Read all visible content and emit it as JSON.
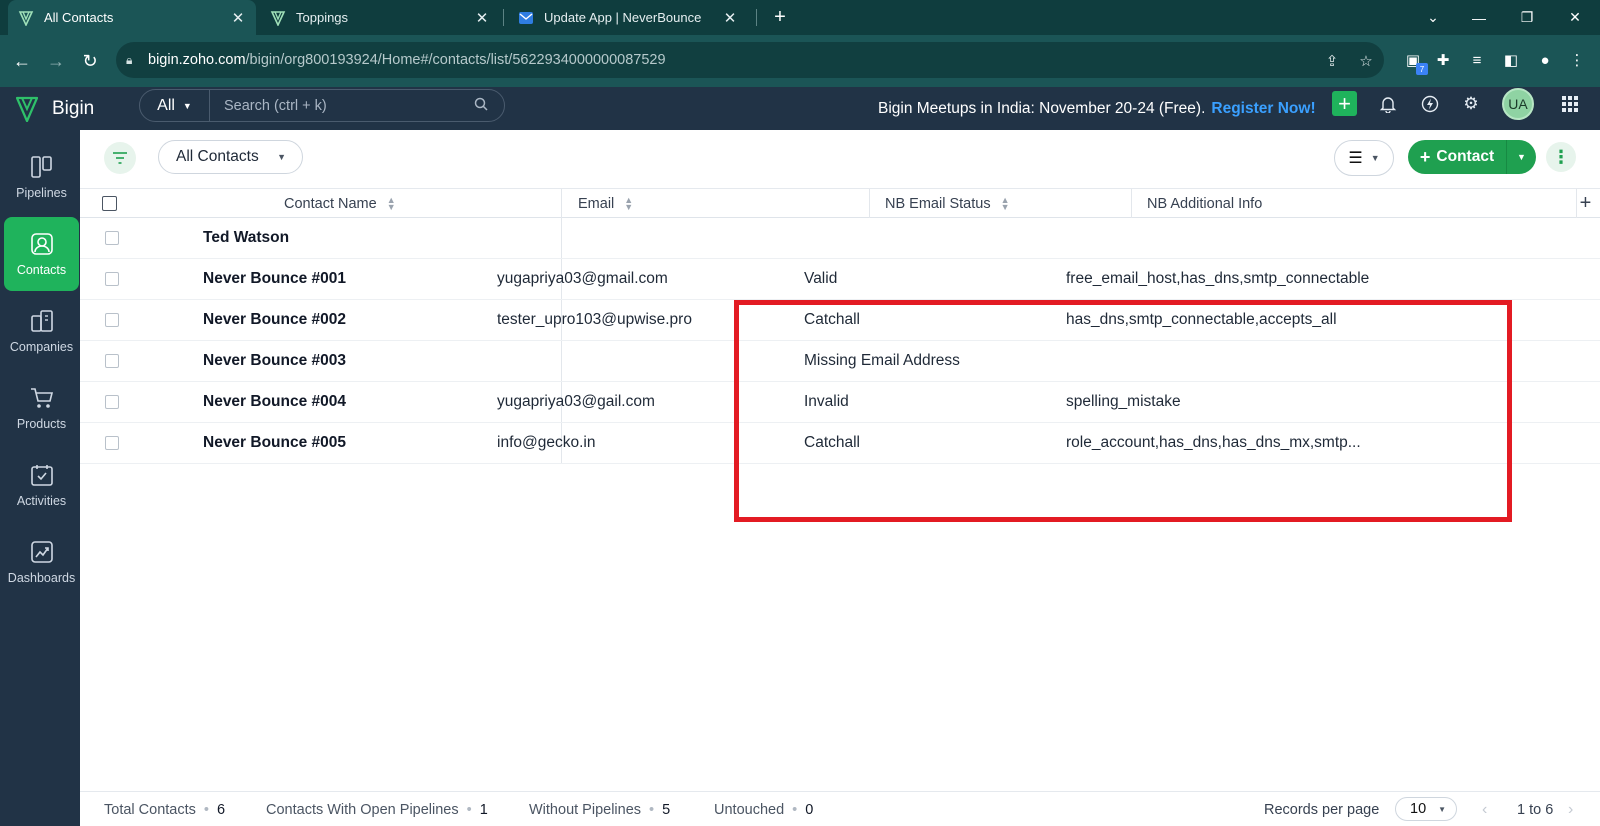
{
  "browser": {
    "tabs": [
      {
        "title": "All Contacts",
        "active": true,
        "icon": "bigin-logo-icon"
      },
      {
        "title": "Toppings",
        "active": false,
        "icon": "bigin-logo-icon"
      },
      {
        "title": "Update App | NeverBounce",
        "active": false,
        "icon": "neverbounce-logo-icon"
      }
    ],
    "url_host": "bigin.zoho.com",
    "url_path": "/bigin/org800193924/Home#/contacts/list/5622934000000087529",
    "extension_badge": "7"
  },
  "app": {
    "name": "Bigin",
    "search_scope": "All",
    "search_placeholder": "Search (ctrl + k)",
    "promo_text": "Bigin Meetups in India: November 20-24 (Free).",
    "promo_link": "Register Now!",
    "avatar_initials": "UA",
    "brand_color": "#1fb35c"
  },
  "sidebar": {
    "items": [
      {
        "label": "Pipelines",
        "icon": "pipelines-icon",
        "active": false
      },
      {
        "label": "Contacts",
        "icon": "contacts-icon",
        "active": true
      },
      {
        "label": "Companies",
        "icon": "companies-icon",
        "active": false
      },
      {
        "label": "Products",
        "icon": "products-icon",
        "active": false
      },
      {
        "label": "Activities",
        "icon": "activities-icon",
        "active": false
      },
      {
        "label": "Dashboards",
        "icon": "dashboards-icon",
        "active": false
      }
    ]
  },
  "toolbar": {
    "view_name": "All Contacts",
    "contact_button": "Contact"
  },
  "table": {
    "columns": [
      "Contact Name",
      "Email",
      "NB Email Status",
      "NB Additional Info"
    ],
    "rows": [
      {
        "name": "Ted Watson",
        "email": "",
        "status": "",
        "info": ""
      },
      {
        "name": "Never Bounce #001",
        "email": "yugapriya03@gmail.com",
        "status": "Valid",
        "info": "free_email_host,has_dns,smtp_connectable"
      },
      {
        "name": "Never Bounce #002",
        "email": "tester_upro103@upwise.pro",
        "status": "Catchall",
        "info": "has_dns,smtp_connectable,accepts_all"
      },
      {
        "name": "Never Bounce #003",
        "email": "",
        "status": "Missing Email Address",
        "info": ""
      },
      {
        "name": "Never Bounce #004",
        "email": "yugapriya03@gail.com",
        "status": "Invalid",
        "info": "spelling_mistake"
      },
      {
        "name": "Never Bounce #005",
        "email": "info@gecko.in",
        "status": "Catchall",
        "info": "role_account,has_dns,has_dns_mx,smtp..."
      }
    ]
  },
  "footer": {
    "total_label": "Total Contacts",
    "total_value": "6",
    "open_label": "Contacts With Open Pipelines",
    "open_value": "1",
    "without_label": "Without Pipelines",
    "without_value": "5",
    "untouched_label": "Untouched",
    "untouched_value": "0",
    "records_per_page_label": "Records per page",
    "records_per_page": "10",
    "page_range": "1 to 6"
  },
  "annotation_color": "#e31b23"
}
